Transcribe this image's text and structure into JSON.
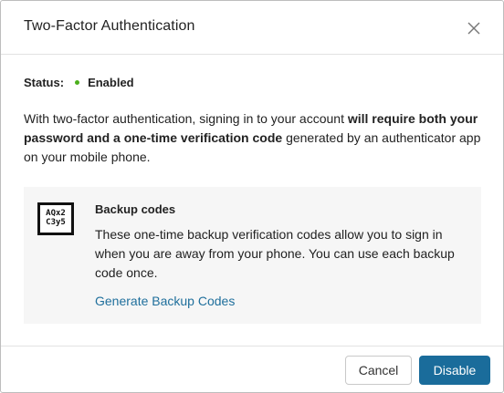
{
  "dialog": {
    "title": "Two-Factor Authentication",
    "close_icon": "close-icon"
  },
  "status": {
    "label": "Status:",
    "value": "Enabled",
    "color": "#4caf1c"
  },
  "description": {
    "part1": "With two-factor authentication, signing in to your account ",
    "bold": "will require both your password and a one-time verification code",
    "part2": " generated by an authenticator app on your mobile phone."
  },
  "backup": {
    "icon_line1": "AQx2",
    "icon_line2": "C3y5",
    "title": "Backup codes",
    "text": "These one-time backup verification codes allow you to sign in when you are away from your phone. You can use each backup code once.",
    "link": "Generate Backup Codes",
    "link_color": "#1f6f9c"
  },
  "footer": {
    "cancel_label": "Cancel",
    "disable_label": "Disable",
    "accent": "#1a6c9b"
  }
}
